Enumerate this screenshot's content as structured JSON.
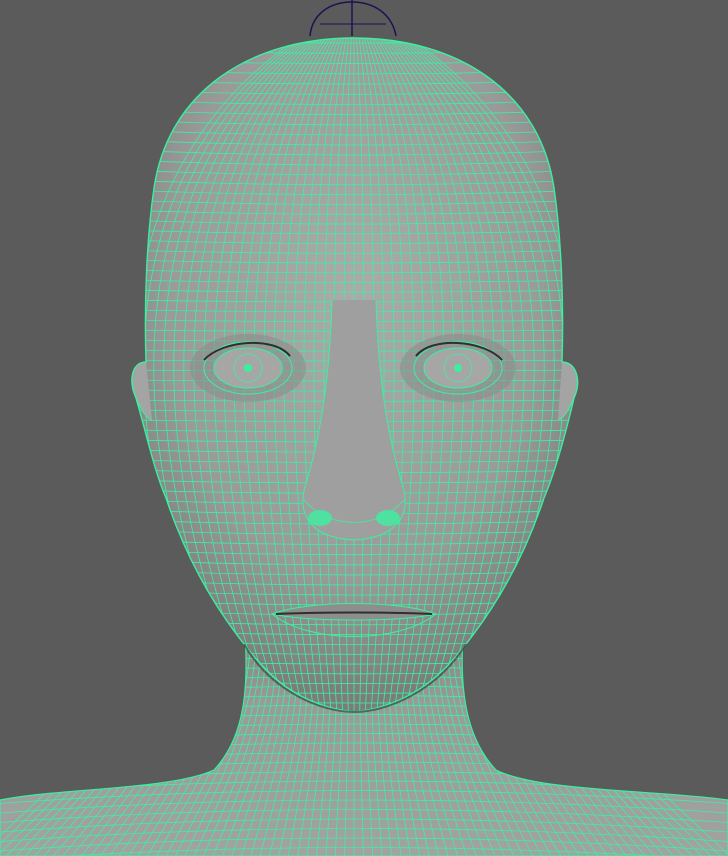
{
  "viewport": {
    "background_color": "#5b5b5b",
    "mesh_surface_color": "#9c9c9c",
    "wireframe_color": "#3cf0a0",
    "selection_handle_color": "#1a1450",
    "display_mode": "wireframe-on-shaded",
    "object": "head-and-shoulders-mesh",
    "selected": true
  },
  "icons": [
    "transform-manipulator-icon"
  ]
}
